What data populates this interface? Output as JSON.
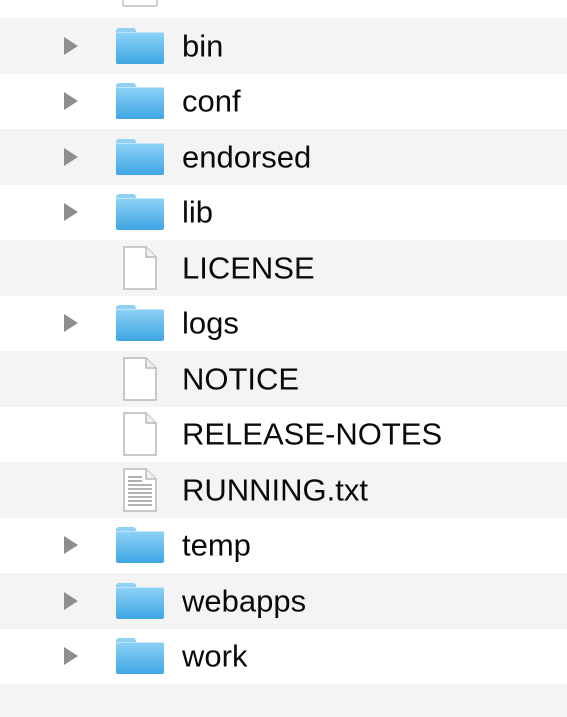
{
  "files": [
    {
      "name": "bin",
      "kind": "folder",
      "icon": "folder-icon"
    },
    {
      "name": "conf",
      "kind": "folder",
      "icon": "folder-icon"
    },
    {
      "name": "endorsed",
      "kind": "folder",
      "icon": "folder-icon"
    },
    {
      "name": "lib",
      "kind": "folder",
      "icon": "folder-icon"
    },
    {
      "name": "LICENSE",
      "kind": "file",
      "icon": "document-icon"
    },
    {
      "name": "logs",
      "kind": "folder",
      "icon": "folder-icon"
    },
    {
      "name": "NOTICE",
      "kind": "file",
      "icon": "document-icon"
    },
    {
      "name": "RELEASE-NOTES",
      "kind": "file",
      "icon": "document-icon"
    },
    {
      "name": "RUNNING.txt",
      "kind": "text-file",
      "icon": "text-document-icon"
    },
    {
      "name": "temp",
      "kind": "folder",
      "icon": "folder-icon"
    },
    {
      "name": "webapps",
      "kind": "folder",
      "icon": "folder-icon"
    },
    {
      "name": "work",
      "kind": "folder",
      "icon": "folder-icon"
    }
  ],
  "colors": {
    "stripe": "#f4f4f4",
    "folder_light": "#8dd2f6",
    "folder_dark": "#3fa6e3",
    "disclosure": "#8e8e8e",
    "text": "#0a0a0a"
  }
}
